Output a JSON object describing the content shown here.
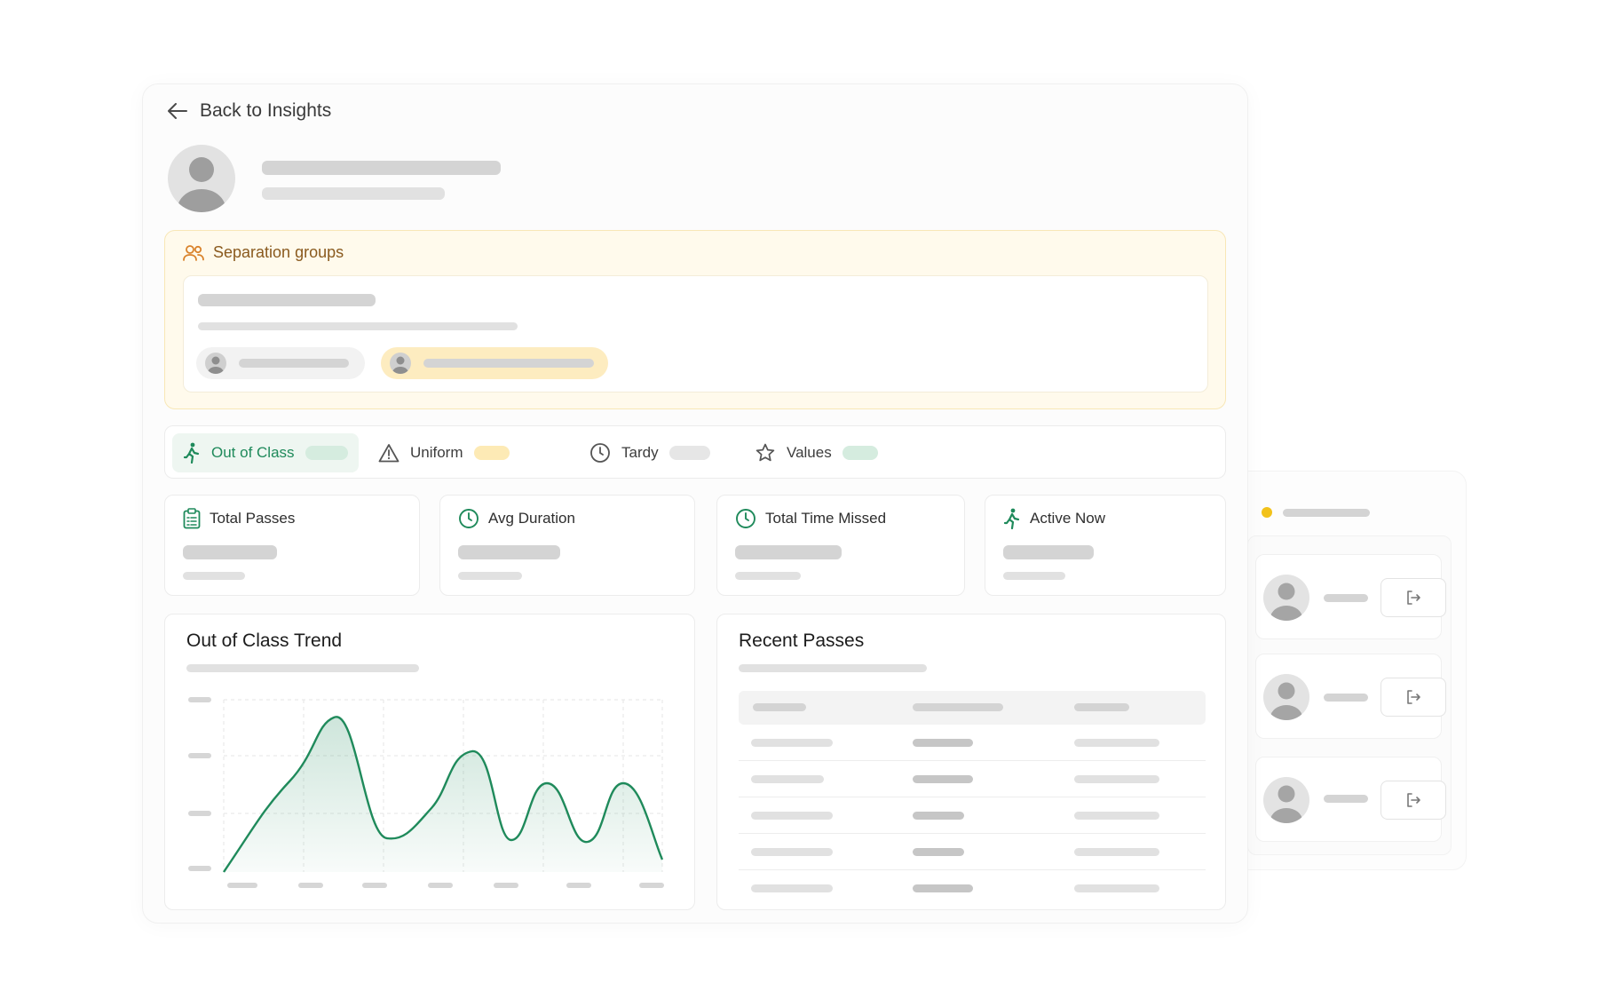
{
  "nav": {
    "back_label": "Back to Insights"
  },
  "separation": {
    "title": "Separation groups"
  },
  "tabs": [
    {
      "label": "Out of Class",
      "icon": "walking-person-icon",
      "active": true
    },
    {
      "label": "Uniform",
      "icon": "warning-triangle-icon",
      "active": false
    },
    {
      "label": "Tardy",
      "icon": "clock-icon",
      "active": false
    },
    {
      "label": "Values",
      "icon": "star-icon",
      "active": false
    }
  ],
  "stats": [
    {
      "label": "Total Passes",
      "icon": "clipboard-icon"
    },
    {
      "label": "Avg Duration",
      "icon": "clock-icon"
    },
    {
      "label": "Total Time Missed",
      "icon": "clock-icon"
    },
    {
      "label": "Active Now",
      "icon": "walking-person-icon"
    }
  ],
  "trend": {
    "title": "Out of Class Trend"
  },
  "recent": {
    "title": "Recent Passes"
  },
  "colors": {
    "accent_green": "#1f8a5b",
    "warning_orange": "#d9822b",
    "status_dot_yellow": "#f2c21b",
    "skeleton_gray": "#d4d4d4"
  }
}
